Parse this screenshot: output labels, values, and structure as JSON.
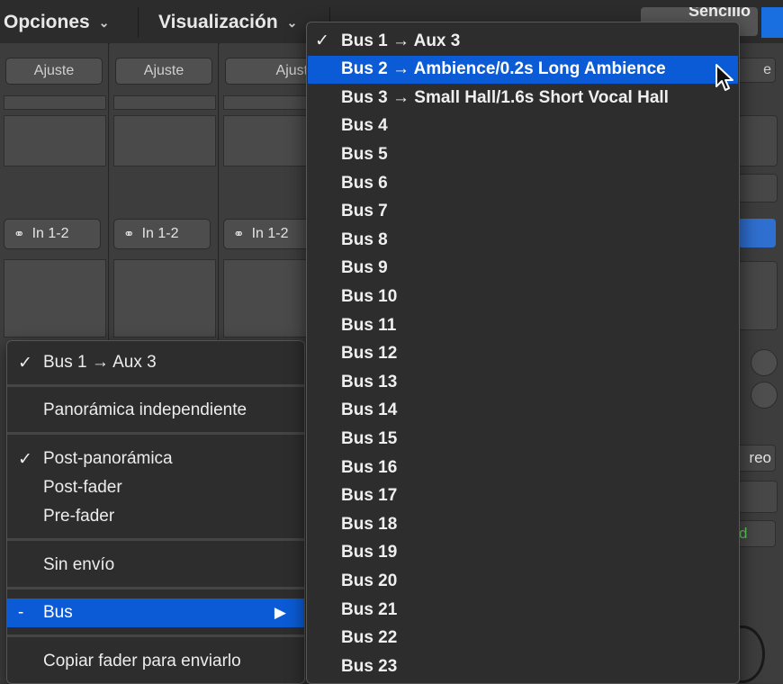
{
  "toolbar": {
    "options_label": "Opciones",
    "view_label": "Visualización",
    "right_label": "Sencillo"
  },
  "strips": [
    {
      "setting_label": "Ajuste",
      "input_label": "In 1-2",
      "link_icon": "stereo-link-icon"
    },
    {
      "setting_label": "Ajuste",
      "input_label": "In 1-2",
      "link_icon": "stereo-link-icon"
    },
    {
      "setting_label": "Ajuste",
      "input_label": "In 1-2",
      "link_icon": "stereo-link-icon"
    }
  ],
  "right_strip": {
    "setting_label": "e",
    "stereo_label": "reo",
    "read_label": "d"
  },
  "context_menu": {
    "checkmark": "✓",
    "send_item": "Bus 1 → Aux 3",
    "independent_pan": "Panorámica independiente",
    "post_pan": "Post-panorámica",
    "post_fader": "Post-fader",
    "pre_fader": "Pre-fader",
    "no_send": "Sin envío",
    "bus_prefix": "-",
    "bus_label": "Bus",
    "bus_arrow": "▶",
    "copy_fader": "Copiar fader para enviarlo"
  },
  "bus_menu": {
    "checkmark": "✓",
    "items": [
      "Bus 1 → Aux 3",
      "Bus 2 → Ambience/0.2s Long Ambience",
      "Bus 3 → Small Hall/1.6s Short Vocal Hall",
      "Bus 4",
      "Bus 5",
      "Bus 6",
      "Bus 7",
      "Bus 8",
      "Bus 9",
      "Bus 10",
      "Bus 11",
      "Bus 12",
      "Bus 13",
      "Bus 14",
      "Bus 15",
      "Bus 16",
      "Bus 17",
      "Bus 18",
      "Bus 19",
      "Bus 20",
      "Bus 21",
      "Bus 22",
      "Bus 23"
    ],
    "selected_index": 0,
    "highlighted_index": 1
  },
  "colors": {
    "highlight": "#0a5bd5",
    "menu_bg": "#2d2d2d",
    "read_green": "#5fd35f"
  }
}
